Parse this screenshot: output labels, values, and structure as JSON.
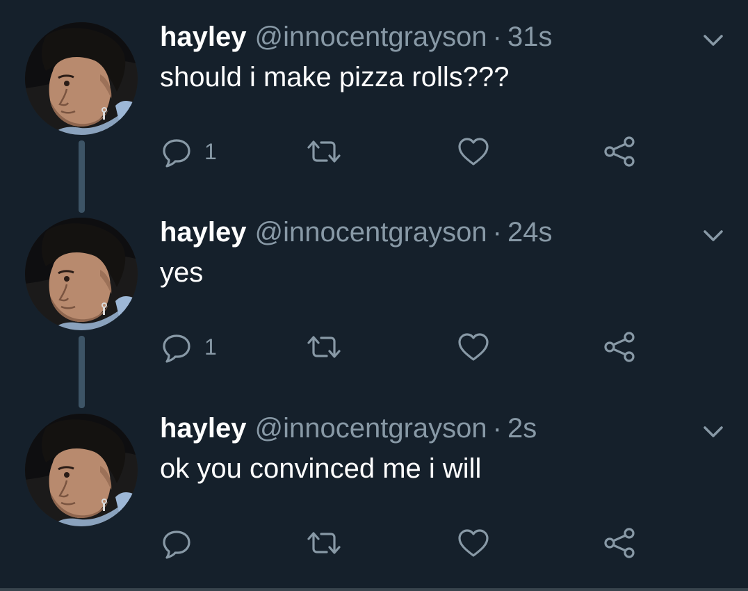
{
  "colors": {
    "background": "#15202b",
    "text": "#ffffff",
    "secondary": "#8899a6",
    "thread_line": "#3d5466"
  },
  "icons": {
    "reply": "reply-icon",
    "retweet": "retweet-icon",
    "like": "heart-icon",
    "share": "share-icon",
    "menu": "chevron-down-icon"
  },
  "tweets": [
    {
      "name": "hayley",
      "handle": "@innocentgrayson",
      "separator": "·",
      "time": "31s",
      "text": "should i make pizza rolls???",
      "reply_count": "1"
    },
    {
      "name": "hayley",
      "handle": "@innocentgrayson",
      "separator": "·",
      "time": "24s",
      "text": "yes",
      "reply_count": "1"
    },
    {
      "name": "hayley",
      "handle": "@innocentgrayson",
      "separator": "·",
      "time": "2s",
      "text": "ok you convinced me i will",
      "reply_count": ""
    }
  ]
}
